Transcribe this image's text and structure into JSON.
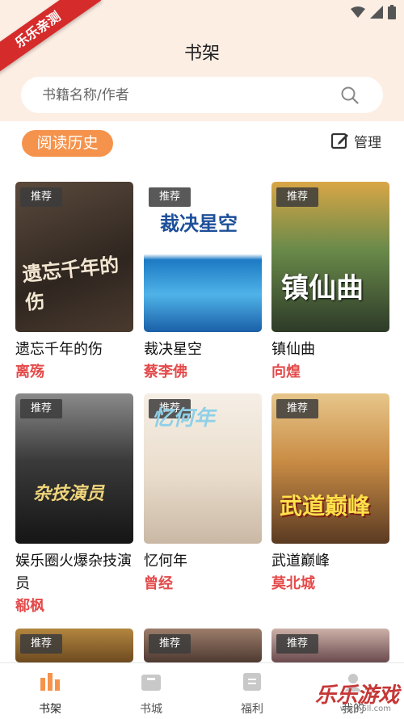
{
  "corner_badge": "乐乐亲测",
  "header": {
    "title": "书架"
  },
  "search": {
    "placeholder": "书籍名称/作者"
  },
  "history_button": "阅读历史",
  "manage_label": "管理",
  "recommend_badge": "推荐",
  "books": [
    {
      "title": "遗忘千年的伤",
      "author": "离殇",
      "cover_text": "遗忘千年的伤"
    },
    {
      "title": "裁决星空",
      "author": "蔡李佛",
      "cover_text": "裁决星空"
    },
    {
      "title": "镇仙曲",
      "author": "向煌",
      "cover_text": "镇仙曲"
    },
    {
      "title": "娱乐圈火爆杂技演员",
      "author": "郗枫",
      "cover_text": "杂技演员"
    },
    {
      "title": "忆何年",
      "author": "曾经",
      "cover_text": "忆何年"
    },
    {
      "title": "武道巅峰",
      "author": "莫北城",
      "cover_text": "武道巅峰"
    }
  ],
  "tabs": [
    {
      "label": "书架"
    },
    {
      "label": "书城"
    },
    {
      "label": "福利"
    },
    {
      "label": "我的"
    }
  ],
  "watermark": {
    "text": "乐乐游戏",
    "sub": "www.6ll.com"
  },
  "colors": {
    "accent": "#f5934c",
    "author": "#e44a4a",
    "header_bg": "#fdeee4"
  }
}
